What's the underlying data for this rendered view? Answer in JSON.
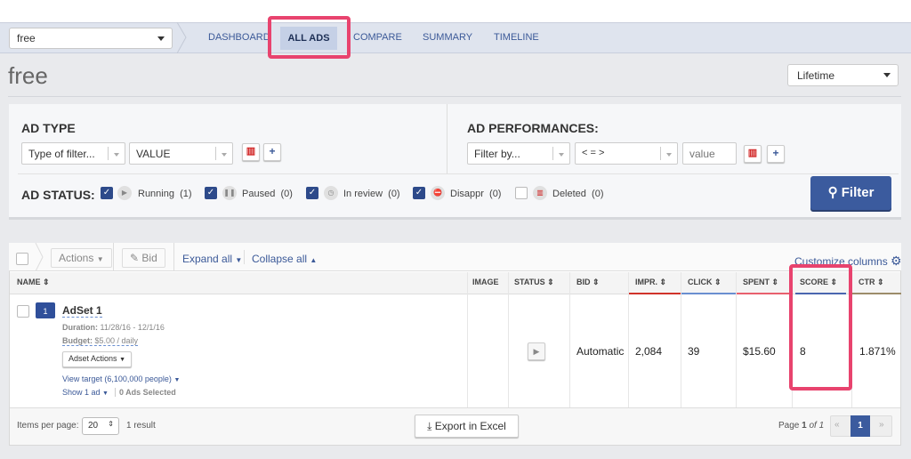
{
  "nav": {
    "account": "free",
    "items": [
      "DASHBOARD",
      "ALL ADS",
      "COMPARE",
      "SUMMARY",
      "TIMELINE"
    ],
    "active": "ALL ADS"
  },
  "page": {
    "title": "free",
    "period": "Lifetime"
  },
  "filters": {
    "ad_type_label": "AD TYPE",
    "type_placeholder": "Type of filter...",
    "value_placeholder": "VALUE",
    "perf_label": "AD PERFORMANCES:",
    "filter_by": "Filter by...",
    "operator": "< = >",
    "value_input_placeholder": "value",
    "filter_button": "Filter"
  },
  "status": {
    "label": "AD STATUS:",
    "items": [
      {
        "label": "Running",
        "count": "(1)",
        "checked": true,
        "icon": "play-icon"
      },
      {
        "label": "Paused",
        "count": "(0)",
        "checked": true,
        "icon": "pause-icon"
      },
      {
        "label": "In review",
        "count": "(0)",
        "checked": true,
        "icon": "clock-icon"
      },
      {
        "label": "Disappr",
        "count": "(0)",
        "checked": true,
        "icon": "blocked-icon"
      },
      {
        "label": "Deleted",
        "count": "(0)",
        "checked": false,
        "icon": "trash-icon"
      }
    ]
  },
  "toolbar": {
    "actions": "Actions",
    "bid": "Bid",
    "expand": "Expand all",
    "collapse": "Collapse all",
    "customize": "Customize columns"
  },
  "table": {
    "columns": [
      "NAME",
      "IMAGE",
      "STATUS",
      "BID",
      "IMPR.",
      "CLICK",
      "SPENT",
      "SCORE",
      "CTR"
    ],
    "row": {
      "name": "AdSet 1",
      "duration_label": "Duration:",
      "duration": "11/28/16 - 12/1/16",
      "budget_label": "Budget:",
      "budget": "$5.00 / daily",
      "actions": "Adset Actions",
      "target": "View target (6,100,000 people)",
      "show": "Show 1 ad",
      "selected": "0 Ads Selected",
      "folder_count": "1",
      "bid": "Automatic",
      "impr": "2,084",
      "click": "39",
      "spent": "$15.60",
      "score": "8",
      "ctr": "1.871%"
    }
  },
  "footer": {
    "items_label": "Items per page:",
    "per_page": "20",
    "results": "1 result",
    "export": "Export in Excel",
    "page_label": "Page",
    "page": "1",
    "of": "of",
    "total": "1"
  },
  "colors": {
    "accent": "#3b5998",
    "highlight": "#e8436e",
    "filter_button": "#3b5b9e"
  }
}
